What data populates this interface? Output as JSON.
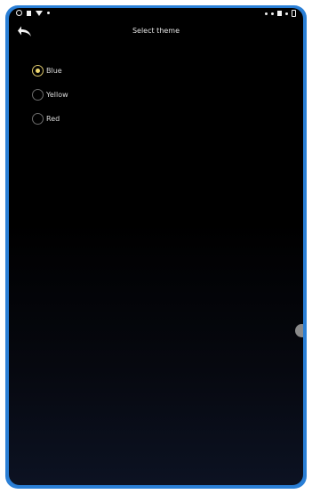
{
  "header": {
    "title": "Select theme"
  },
  "theme_options": [
    {
      "label": "Blue",
      "checked": true
    },
    {
      "label": "Yellow",
      "checked": false
    },
    {
      "label": "Red",
      "checked": false
    }
  ],
  "colors": {
    "frame": "#2a7fd6",
    "selected_radio": "#f0d970",
    "background": "#000000"
  }
}
